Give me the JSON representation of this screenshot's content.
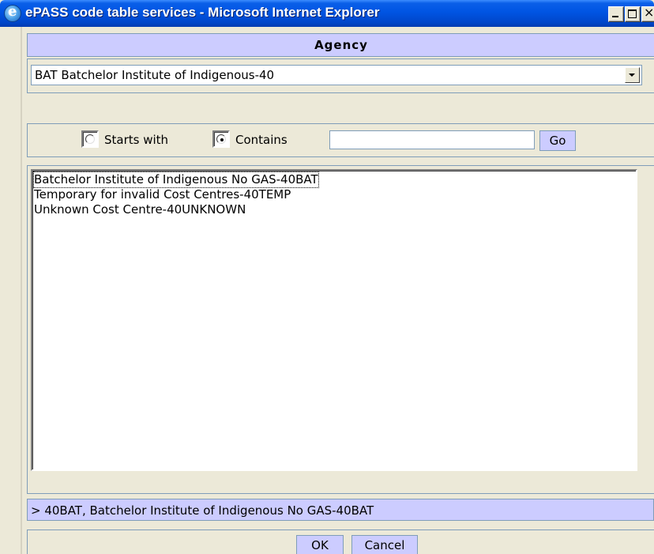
{
  "window": {
    "title": "ePASS code table services - Microsoft Internet Explorer"
  },
  "header": {
    "title": "Agency"
  },
  "agency_select": {
    "selected": "BAT Batchelor Institute of Indigenous-40"
  },
  "search": {
    "starts_with_label": "Starts with",
    "contains_label": "Contains",
    "starts_with_checked": false,
    "contains_checked": true,
    "value": "",
    "go_label": "Go"
  },
  "results": [
    {
      "label": "Batchelor Institute of Indigenous No GAS-40BAT",
      "selected": true
    },
    {
      "label": "Temporary for invalid Cost Centres-40TEMP",
      "selected": false
    },
    {
      "label": "Unknown Cost Centre-40UNKNOWN",
      "selected": false
    }
  ],
  "selection": {
    "text": "> 40BAT, Batchelor Institute of Indigenous No GAS-40BAT"
  },
  "footer": {
    "ok_label": "OK",
    "cancel_label": "Cancel"
  },
  "colors": {
    "titlebar": "#0054e3",
    "header_bg": "#ccccff",
    "window_bg": "#ece9d8"
  }
}
